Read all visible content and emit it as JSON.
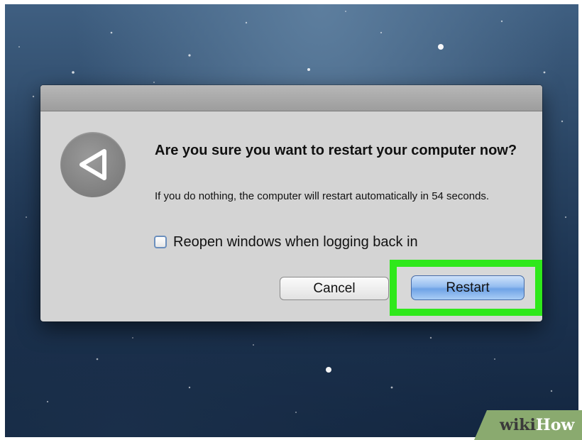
{
  "dialog": {
    "heading": "Are you sure you want to restart your computer now?",
    "message": "If you do nothing, the computer will restart automatically in 54 seconds.",
    "checkbox": {
      "label": "Reopen windows when logging back in",
      "checked": false
    },
    "buttons": {
      "cancel_label": "Cancel",
      "restart_label": "Restart"
    },
    "icon": "restart-arrow-icon"
  },
  "highlight": {
    "color": "#2fe81b",
    "target": "Restart"
  },
  "watermark": {
    "part1": "wiki",
    "part2": "How"
  },
  "colors": {
    "accent_button": "#6fa3e6",
    "dialog_bg": "#d4d4d4"
  }
}
